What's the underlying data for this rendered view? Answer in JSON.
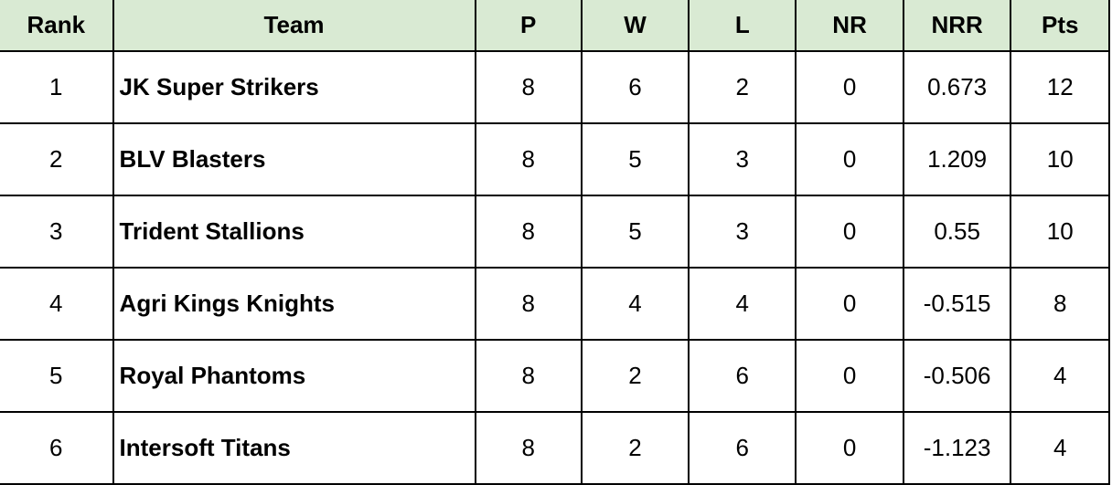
{
  "table": {
    "header_bg": "#d9ead3",
    "columns": [
      "Rank",
      "Team",
      "P",
      "W",
      "L",
      "NR",
      "NRR",
      "Pts"
    ],
    "rows": [
      {
        "rank": "1",
        "team": "JK Super Strikers",
        "p": "8",
        "w": "6",
        "l": "2",
        "nr": "0",
        "nrr": "0.673",
        "pts": "12"
      },
      {
        "rank": "2",
        "team": "BLV Blasters",
        "p": "8",
        "w": "5",
        "l": "3",
        "nr": "0",
        "nrr": "1.209",
        "pts": "10"
      },
      {
        "rank": "3",
        "team": "Trident Stallions",
        "p": "8",
        "w": "5",
        "l": "3",
        "nr": "0",
        "nrr": "0.55",
        "pts": "10"
      },
      {
        "rank": "4",
        "team": "Agri Kings Knights",
        "p": "8",
        "w": "4",
        "l": "4",
        "nr": "0",
        "nrr": "-0.515",
        "pts": "8"
      },
      {
        "rank": "5",
        "team": "Royal Phantoms",
        "p": "8",
        "w": "2",
        "l": "6",
        "nr": "0",
        "nrr": "-0.506",
        "pts": "4"
      },
      {
        "rank": "6",
        "team": "Intersoft Titans",
        "p": "8",
        "w": "2",
        "l": "6",
        "nr": "0",
        "nrr": "-1.123",
        "pts": "4"
      }
    ]
  }
}
